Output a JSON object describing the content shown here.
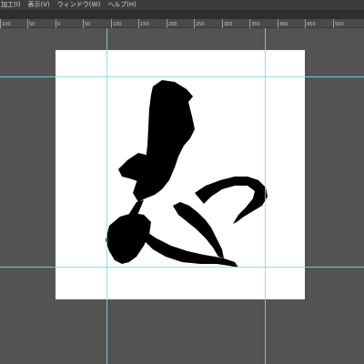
{
  "menu": {
    "items": [
      "加工(I)",
      "表示(V)",
      "ウィンドウ(W)",
      "ヘルプ(H)"
    ]
  },
  "ruler": {
    "ticks": [
      "100",
      "50",
      "0",
      "50",
      "100",
      "150",
      "200",
      "250",
      "300",
      "350",
      "400",
      "450",
      "500"
    ]
  },
  "colors": {
    "workspace": "#535353",
    "document": "#ffffff",
    "guide": "#7fd9e8",
    "ink": "#000000"
  },
  "icons": {
    "artwork": "calligraphy-brush-stroke"
  }
}
